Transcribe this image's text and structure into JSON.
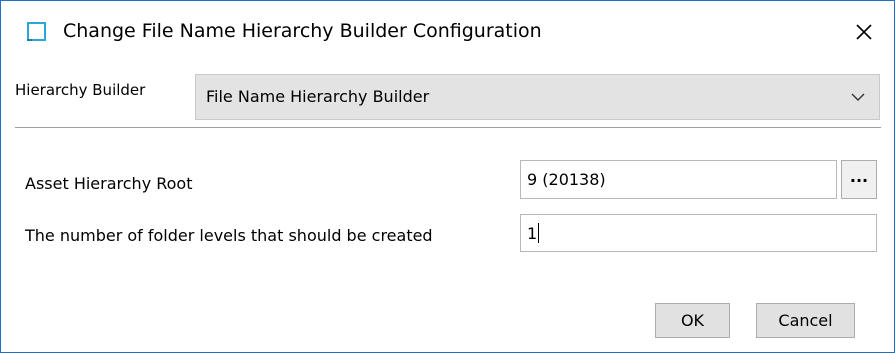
{
  "window": {
    "title": "Change File Name Hierarchy Builder Configuration",
    "accent_color": "#1f6fc5"
  },
  "icons": {
    "app": "app-window-icon",
    "close": "close-icon",
    "dropdown": "chevron-down-icon"
  },
  "hierarchy_builder": {
    "label": "Hierarchy Builder",
    "selected": "File Name Hierarchy Builder"
  },
  "fields": {
    "asset_root": {
      "label": "Asset Hierarchy Root",
      "value": "9 (20138)",
      "browse_label": "..."
    },
    "folder_levels": {
      "label": "The number of folder levels that should be created",
      "value": "1"
    }
  },
  "buttons": {
    "ok": "OK",
    "cancel": "Cancel"
  }
}
